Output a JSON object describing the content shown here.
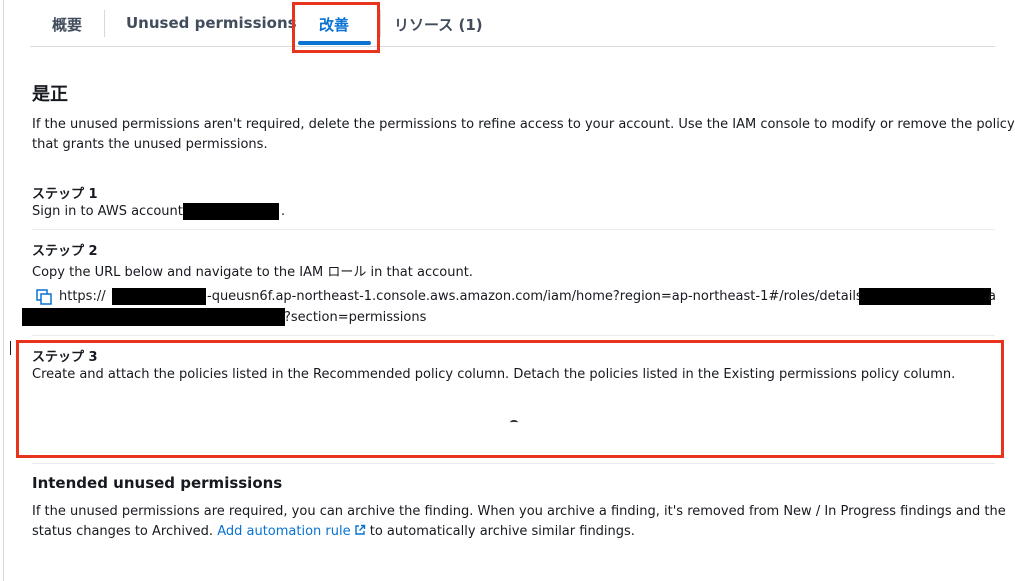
{
  "tabs": [
    {
      "label": "概要"
    },
    {
      "label": "Unused permissions"
    },
    {
      "label": "改善"
    },
    {
      "label": "リソース (1)"
    }
  ],
  "remediation": {
    "title": "是正",
    "intro_line1": "If the unused permissions aren't required, delete the permissions to refine access to your account. Use the IAM console to modify or remove the policy",
    "intro_line2": "that grants the unused permissions.",
    "step1_title": "ステップ 1",
    "step1_text": "Sign in to AWS account",
    "step1_suffix": ".",
    "step2_title": "ステップ 2",
    "step2_text": "Copy the URL below and navigate to the IAM ロール in that account.",
    "url_prefix": "https://",
    "url_middle": "-queusn6f.ap-northeast-1.console.aws.amazon.com/iam/home?region=ap-northeast-1#/roles/details/",
    "url_tail_char": "a",
    "url_suffix": "?section=permissions",
    "step3_title": "ステップ 3",
    "step3_text": "Create and attach the policies listed in the Recommended policy column. Detach the policies listed in the Existing permissions policy column."
  },
  "intended": {
    "title": "Intended unused permissions",
    "line1": "If the unused permissions are required, you can archive the finding. When you archive a finding, it's removed from New / In Progress findings and the",
    "line2_before": "status changes to Archived.",
    "link_label": "Add automation rule",
    "line2_after": "to automatically archive similar findings."
  },
  "colors": {
    "accent": "#0972d3",
    "highlight": "#e8341c"
  },
  "icons": {
    "copy": "copy-icon",
    "external": "external-link-icon"
  }
}
